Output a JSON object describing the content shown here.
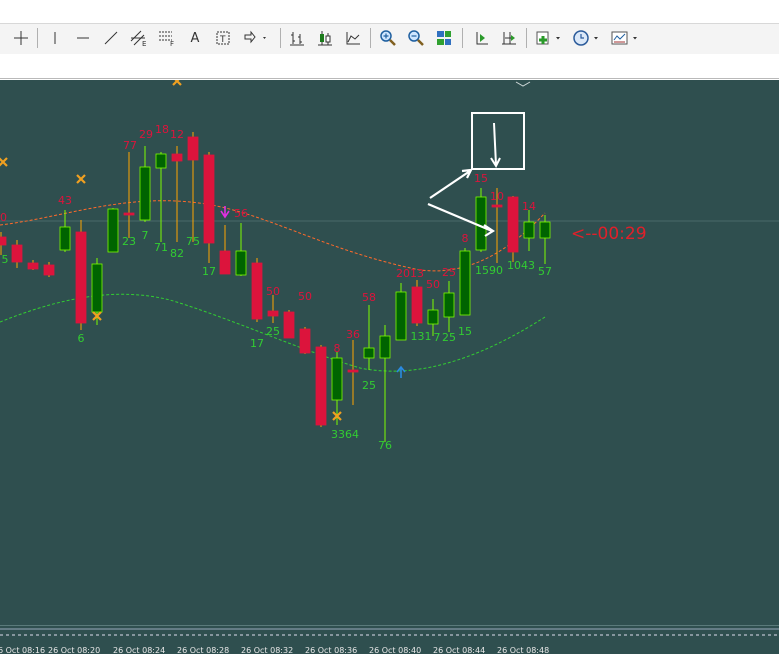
{
  "toolbar": {
    "buttons": [
      {
        "name": "crosshair-button",
        "icon": "crosshair-icon"
      },
      {
        "name": "vertical-line-button",
        "icon": "vertical-line-icon"
      },
      {
        "name": "horizontal-line-button",
        "icon": "horizontal-line-icon"
      },
      {
        "name": "trendline-button",
        "icon": "trendline-icon"
      },
      {
        "name": "equidistant-channel-button",
        "icon": "channel-icon",
        "glyph_sub": "E"
      },
      {
        "name": "fibonacci-button",
        "icon": "fibonacci-icon",
        "glyph_sub": "F"
      },
      {
        "name": "text-button",
        "icon": "text-icon",
        "glyph": "A"
      },
      {
        "name": "text-label-button",
        "icon": "text-label-icon",
        "glyph": "T"
      },
      {
        "name": "arrows-dropdown-button",
        "icon": "arrows-icon"
      },
      {
        "name": "bar-chart-button",
        "icon": "bar-chart-icon"
      },
      {
        "name": "candlestick-button",
        "icon": "candlestick-icon"
      },
      {
        "name": "line-chart-button",
        "icon": "line-chart-icon"
      },
      {
        "name": "zoom-in-button",
        "icon": "zoom-in-icon"
      },
      {
        "name": "zoom-out-button",
        "icon": "zoom-out-icon"
      },
      {
        "name": "tile-windows-button",
        "icon": "tile-windows-icon"
      },
      {
        "name": "chart-shift-button",
        "icon": "chart-shift-icon"
      },
      {
        "name": "autoscroll-button",
        "icon": "autoscroll-icon"
      },
      {
        "name": "indicators-dropdown-button",
        "icon": "indicators-icon"
      },
      {
        "name": "periods-dropdown-button",
        "icon": "clock-icon"
      },
      {
        "name": "templates-dropdown-button",
        "icon": "templates-icon"
      }
    ]
  },
  "chart": {
    "timer_label": "<--00:29",
    "colors": {
      "background": "#2f4f4f",
      "bull": "#006400",
      "bear": "#dc143c",
      "wick_bull": "#7cfc00",
      "wick_bear": "#ffa500",
      "label_red": "#dc143c",
      "label_green": "#32cd32",
      "cross": "#f0a020",
      "upper_band": "#ff6a2a",
      "lower_band": "#32cd32",
      "timer": "#e0202a"
    },
    "red_labels": [
      "10",
      "43",
      "77",
      "29",
      "18",
      "12",
      "56",
      "50",
      "50",
      "36",
      "8",
      "58",
      "20",
      "13",
      "50",
      "25",
      "8",
      "15",
      "10",
      "14"
    ],
    "green_labels": [
      "5",
      "6",
      "23",
      "7",
      "71",
      "82",
      "75",
      "17",
      "17",
      "25",
      "25",
      "3364",
      "76",
      "131",
      "7",
      "25",
      "15",
      "1590",
      "1043",
      "57"
    ]
  },
  "timeline": {
    "labels": [
      "6 Oct 08:16",
      "26 Oct 08:20",
      "26 Oct 08:24",
      "26 Oct 08:28",
      "26 Oct 08:32",
      "26 Oct 08:36",
      "26 Oct 08:40",
      "26 Oct 08:44",
      "26 Oct 08:48"
    ]
  }
}
